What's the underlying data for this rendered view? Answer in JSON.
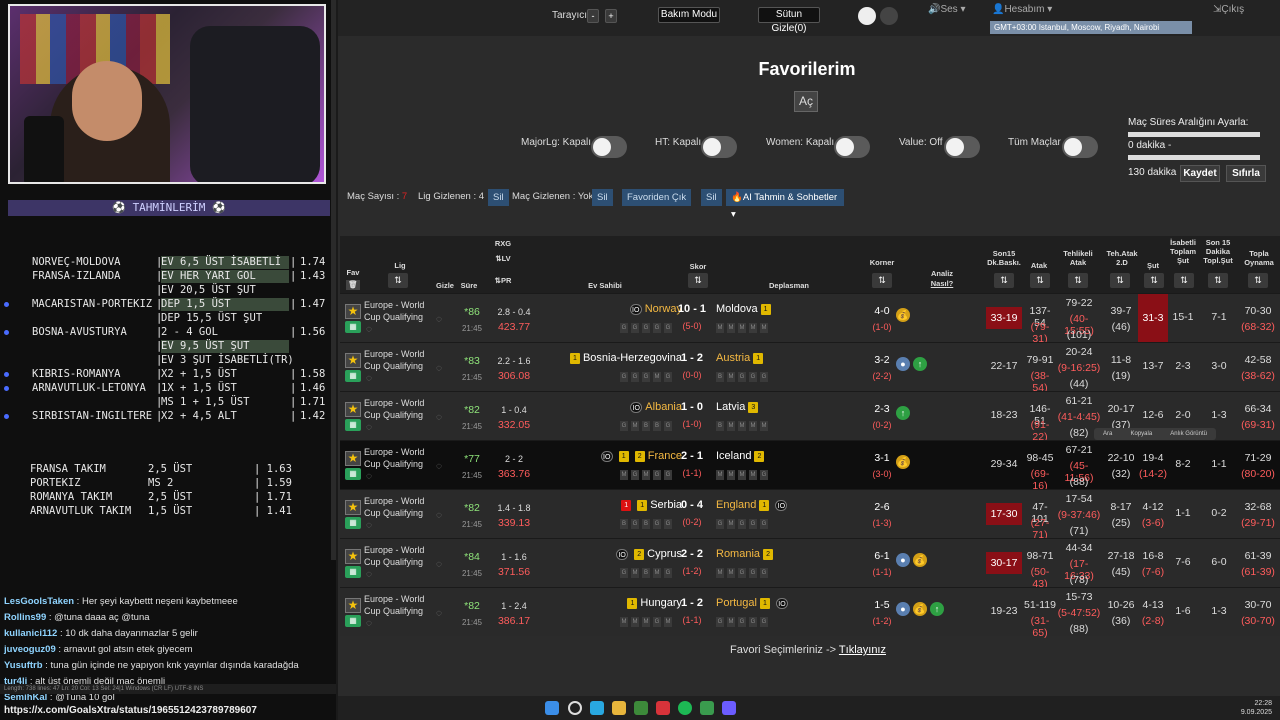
{
  "stream": {
    "predictions_title": "TAHMİNLERİM",
    "predictions": [
      {
        "match": "NORVEÇ-MOLDOVA",
        "pick": "EV 6,5 ÜST İSABETLİ",
        "odd": "1.74",
        "hl": true,
        "dot": false
      },
      {
        "match": "FRANSA-IZLANDA",
        "pick": "EV HER YARI GOL",
        "odd": "1.43",
        "hl": true,
        "dot": false
      },
      {
        "match": "",
        "pick": "EV 20,5 ÜST ŞUT",
        "odd": "",
        "hl": false,
        "dot": false
      },
      {
        "match": "MACARISTAN-PORTEKIZ",
        "pick": "DEP 1,5 ÜST",
        "odd": "1.47",
        "hl": true,
        "dot": true
      },
      {
        "match": "",
        "pick": "DEP 15,5 ÜST ŞUT",
        "odd": "",
        "hl": false,
        "dot": false
      },
      {
        "match": "BOSNA-AVUSTURYA",
        "pick": "2 - 4 GOL",
        "odd": "1.56",
        "hl": false,
        "dot": true
      },
      {
        "match": "",
        "pick": "EV 9,5 ÜST ŞUT",
        "odd": "",
        "hl": true,
        "dot": false
      },
      {
        "match": "",
        "pick": "EV 3 ŞUT İSABETLİ(TR)",
        "odd": "",
        "hl": false,
        "dot": false
      },
      {
        "match": "KIBRIS-ROMANYA",
        "pick": "X2 + 1,5 ÜST",
        "odd": "1.58",
        "hl": false,
        "dot": true
      },
      {
        "match": "ARNAVUTLUK-LETONYA",
        "pick": "1X + 1,5 ÜST",
        "odd": "1.46",
        "hl": false,
        "dot": true
      },
      {
        "match": "",
        "pick": "MS 1 + 1,5 ÜST",
        "odd": "1.71",
        "hl": false,
        "dot": false
      },
      {
        "match": "SIRBISTAN-INGILTERE",
        "pick": "X2 + 4,5 ALT",
        "odd": "1.42",
        "hl": false,
        "dot": true
      }
    ],
    "summary": [
      {
        "team": "FRANSA TAKIM",
        "pick": "2,5 ÜST",
        "odd": "1.63"
      },
      {
        "team": "PORTEKIZ",
        "pick": "MS 2",
        "odd": "1.59"
      },
      {
        "team": "ROMANYA TAKIM",
        "pick": "2,5 ÜST",
        "odd": "1.71"
      },
      {
        "team": "ARNAVUTLUK TAKIM",
        "pick": "1,5 ÜST",
        "odd": "1.41"
      }
    ],
    "chat": [
      {
        "user": "LesGoolsTaken",
        "text": "Her şeyi kaybettt neşeni kaybetmeee"
      },
      {
        "user": "Rollins99",
        "text": "@tuna daaa aç @tuna"
      },
      {
        "user": "kullanici112",
        "text": "10 dk daha dayanmazlar 5 gelir"
      },
      {
        "user": "juveoguz09",
        "text": "arnavut gol atsın etek giyecem"
      },
      {
        "user": "Yusuftrb",
        "text": "tuna gün içinde ne yapıyon knk yayınlar dışında karadağda"
      },
      {
        "user": "tur4li",
        "text": "alt üst önemli değil maç önemli"
      },
      {
        "user": "SemihKal",
        "text": "@Tuna 10 gol"
      }
    ],
    "url": "https://x.com/GoalsXtra/status/1965512423789789607",
    "editor_status": "Length: 738   lines: 47     Ln: 20   Col: 13   Sel: 24|1                 Windows (CR LF)    UTF-8              INS"
  },
  "app": {
    "topbar": {
      "scanner_label": "Tarayıcı",
      "minus": "-",
      "plus": "+",
      "maintenance": "Bakım Modu",
      "hide_col": "Sütun Gizle(0)",
      "sound": "Ses",
      "account": "Hesabım",
      "logout": "Çıkış",
      "timezone": "GMT+03:00 Istanbul, Moscow, Riyadh, Nairobi"
    },
    "title": "Favorilerim",
    "open_btn": "Aç",
    "switches": [
      {
        "label": "MajorLg: Kapalı"
      },
      {
        "label": "HT: Kapalı"
      },
      {
        "label": "Women: Kapalı"
      },
      {
        "label": "Value: Off"
      },
      {
        "label": "Tüm Maçlar"
      }
    ],
    "range": {
      "label": "Maç Süres Aralığını Ayarla:",
      "from": "0 dakika -",
      "to": "130 dakika",
      "save": "Kaydet",
      "reset": "Sıfırla"
    },
    "filter": {
      "match_count_label": "Maç Sayısı :",
      "match_count": "7",
      "lig_hidden": "Lig Gizlenen : 4",
      "sil": "Sil",
      "mac_hidden": "Maç Gizlenen : Yok",
      "remove_fav": "Favoriden Çık",
      "ai": "AI Tahmin & Sohbetler"
    },
    "headers": {
      "fav": "Fav",
      "lig": "Lig",
      "gizle": "Gizle",
      "sure": "Süre",
      "rxg": "RXG",
      "lv": "LV",
      "pr": "PR",
      "home": "Ev Sahibi",
      "score": "Skor",
      "away": "Deplasman",
      "corner": "Korner",
      "analysis": "Analiz",
      "how": "Nasıl?",
      "son15": "Son15 Dk.Baskı.",
      "attack": "Atak",
      "danger": "Tehlikeli Atak",
      "teh2d": "Teh.Atak 2.D",
      "shot": "Şut",
      "on_target": "İsabetli Toplam Şut",
      "last15": "Son 15 Dakika Topl.Şut",
      "total": "Topla Oynama"
    },
    "rows": [
      {
        "league": "Europe - World Cup Qualifying",
        "min": "86",
        "ko": "21:45",
        "rxg": "2.8 - 0.4",
        "odd": "423.77",
        "home": "Norway",
        "away": "Moldova",
        "score": "10 - 1",
        "ht": "(5-0)",
        "hb": [
          "io"
        ],
        "ab": [
          "1"
        ],
        "hform": [
          "G",
          "G",
          "G",
          "G",
          "G"
        ],
        "aform": [
          "M",
          "M",
          "M",
          "M",
          "M"
        ],
        "corner": "4-0",
        "corner_ht": "(1-0)",
        "ana": [
          "bag"
        ],
        "son15": "33-19",
        "son15_hot": true,
        "atk": "137-54",
        "atk_ht": "(79-31)",
        "teh": "79-22",
        "teh_ht": "(40-15:55)",
        "teh3": "(101)",
        "teh2": "39-7",
        "teh2_b": "(46)",
        "sut": "31-3",
        "sut_hot": true,
        "sut_ht": "",
        "isb": "15-1",
        "l15": "7-1",
        "top": "70-30",
        "top_ht": "(68-32)",
        "dark": false
      },
      {
        "league": "Europe - World Cup Qualifying",
        "min": "83",
        "ko": "21:45",
        "rxg": "2.2 - 1.6",
        "odd": "306.08",
        "home": "Bosnia-Herzegovina",
        "away": "Austria",
        "score": "1 - 2",
        "ht": "(0-0)",
        "hb": [
          "1"
        ],
        "ab": [
          "1"
        ],
        "hform": [
          "G",
          "G",
          "G",
          "M",
          "G"
        ],
        "aform": [
          "B",
          "M",
          "G",
          "G",
          "G"
        ],
        "corner": "3-2",
        "corner_ht": "(2-2)",
        "ana": [
          "bomb",
          "up"
        ],
        "son15": "22-17",
        "son15_hot": false,
        "atk": "79-91",
        "atk_ht": "(38-54)",
        "teh": "20-24",
        "teh_ht": "(9-16:25)",
        "teh3": "(44)",
        "teh2": "11-8",
        "teh2_b": "(19)",
        "sut": "13-7",
        "sut_hot": false,
        "sut_ht": "",
        "isb": "2-3",
        "l15": "3-0",
        "top": "42-58",
        "top_ht": "(38-62)",
        "dark": false
      },
      {
        "league": "Europe - World Cup Qualifying",
        "min": "82",
        "ko": "21:45",
        "rxg": "1 - 0.4",
        "odd": "332.05",
        "home": "Albania",
        "away": "Latvia",
        "score": "1 - 0",
        "ht": "(1-0)",
        "hb": [
          "io"
        ],
        "ab": [
          "3"
        ],
        "hform": [
          "G",
          "M",
          "B",
          "B",
          "G"
        ],
        "aform": [
          "B",
          "M",
          "M",
          "M",
          "M"
        ],
        "corner": "2-3",
        "corner_ht": "(0-2)",
        "ana": [
          "up"
        ],
        "son15": "18-23",
        "son15_hot": false,
        "atk": "146-51",
        "atk_ht": "(91-22)",
        "teh": "61-21",
        "teh_ht": "(41-4:45)",
        "teh3": "(82)",
        "teh2": "20-17",
        "teh2_b": "(37)",
        "sut": "12-6",
        "sut_hot": false,
        "sut_ht": "",
        "isb": "2-0",
        "l15": "1-3",
        "top": "66-34",
        "top_ht": "(69-31)",
        "dark": false
      },
      {
        "league": "Europe - World Cup Qualifying",
        "min": "77",
        "ko": "21:45",
        "rxg": "2 - 2",
        "odd": "363.76",
        "home": "France",
        "away": "Iceland",
        "score": "2 - 1",
        "ht": "(1-1)",
        "hb": [
          "io",
          "1",
          "2"
        ],
        "ab": [
          "2"
        ],
        "hform": [
          "M",
          "G",
          "M",
          "G",
          "G"
        ],
        "aform": [
          "M",
          "M",
          "M",
          "M",
          "G"
        ],
        "corner": "3-1",
        "corner_ht": "(3-0)",
        "ana": [
          "bag"
        ],
        "son15": "29-34",
        "son15_hot": false,
        "atk": "98-45",
        "atk_ht": "(69-16)",
        "teh": "67-21",
        "teh_ht": "(45-11:56)",
        "teh3": "(88)",
        "teh2": "22-10",
        "teh2_b": "(32)",
        "sut": "19-4",
        "sut_hot": false,
        "sut_ht": "(14-2)",
        "isb": "8-2",
        "l15": "1-1",
        "top": "71-29",
        "top_ht": "(80-20)",
        "dark": true
      },
      {
        "league": "Europe - World Cup Qualifying",
        "min": "82",
        "ko": "21:45",
        "rxg": "1.4 - 1.8",
        "odd": "339.13",
        "home": "Serbia",
        "away": "England",
        "score": "0 - 4",
        "ht": "(0-2)",
        "hb": [
          "r1",
          "1"
        ],
        "ab": [
          "1",
          "io"
        ],
        "hform": [
          "B",
          "G",
          "B",
          "G",
          "G"
        ],
        "aform": [
          "G",
          "M",
          "G",
          "G",
          "G"
        ],
        "corner": "2-6",
        "corner_ht": "(1-3)",
        "ana": [],
        "son15": "17-30",
        "son15_hot": true,
        "atk": "47-101",
        "atk_ht": "(27-71)",
        "teh": "17-54",
        "teh_ht": "(9-37:46)",
        "teh3": "(71)",
        "teh2": "8-17",
        "teh2_b": "(25)",
        "sut": "4-12",
        "sut_hot": false,
        "sut_ht": "(3-6)",
        "isb": "1-1",
        "l15": "0-2",
        "top": "32-68",
        "top_ht": "(29-71)",
        "dark": false
      },
      {
        "league": "Europe - World Cup Qualifying",
        "min": "84",
        "ko": "21:45",
        "rxg": "1 - 1.6",
        "odd": "371.56",
        "home": "Cyprus",
        "away": "Romania",
        "score": "2 - 2",
        "ht": "(1-2)",
        "hb": [
          "io",
          "2"
        ],
        "ab": [
          "2"
        ],
        "hform": [
          "G",
          "M",
          "B",
          "M",
          "G"
        ],
        "aform": [
          "M",
          "M",
          "G",
          "G",
          "G"
        ],
        "corner": "6-1",
        "corner_ht": "(1-1)",
        "ana": [
          "bomb",
          "bag"
        ],
        "son15": "30-17",
        "son15_hot": true,
        "atk": "98-71",
        "atk_ht": "(50-43)",
        "teh": "44-34",
        "teh_ht": "(17-16:33)",
        "teh3": "(78)",
        "teh2": "27-18",
        "teh2_b": "(45)",
        "sut": "16-8",
        "sut_hot": false,
        "sut_ht": "(7-6)",
        "isb": "7-6",
        "l15": "6-0",
        "top": "61-39",
        "top_ht": "(61-39)",
        "dark": false
      },
      {
        "league": "Europe - World Cup Qualifying",
        "min": "82",
        "ko": "21:45",
        "rxg": "1 - 2.4",
        "odd": "386.17",
        "home": "Hungary",
        "away": "Portugal",
        "score": "1 - 2",
        "ht": "(1-1)",
        "hb": [
          "1"
        ],
        "ab": [
          "1",
          "io"
        ],
        "hform": [
          "M",
          "M",
          "M",
          "G",
          "M"
        ],
        "aform": [
          "G",
          "M",
          "G",
          "G",
          "G"
        ],
        "corner": "1-5",
        "corner_ht": "(1-2)",
        "ana": [
          "bomb",
          "bag",
          "up"
        ],
        "son15": "19-23",
        "son15_hot": false,
        "atk": "51-119",
        "atk_ht": "(31-65)",
        "teh": "15-73",
        "teh_ht": "(5-47:52)",
        "teh3": "(88)",
        "teh2": "10-26",
        "teh2_b": "(36)",
        "sut": "4-13",
        "sut_hot": false,
        "sut_ht": "(2-8)",
        "isb": "1-6",
        "l15": "1-3",
        "top": "30-70",
        "top_ht": "(30-70)",
        "dark": false
      }
    ],
    "context_menu": [
      "Ara",
      "Kopyala",
      "Anlık Görüntü"
    ],
    "footer_text": "Favori Seçimleriniz -> ",
    "footer_link": "Tıklayınız"
  },
  "taskbar": {
    "time": "22:28",
    "date": "9.09.2025"
  }
}
